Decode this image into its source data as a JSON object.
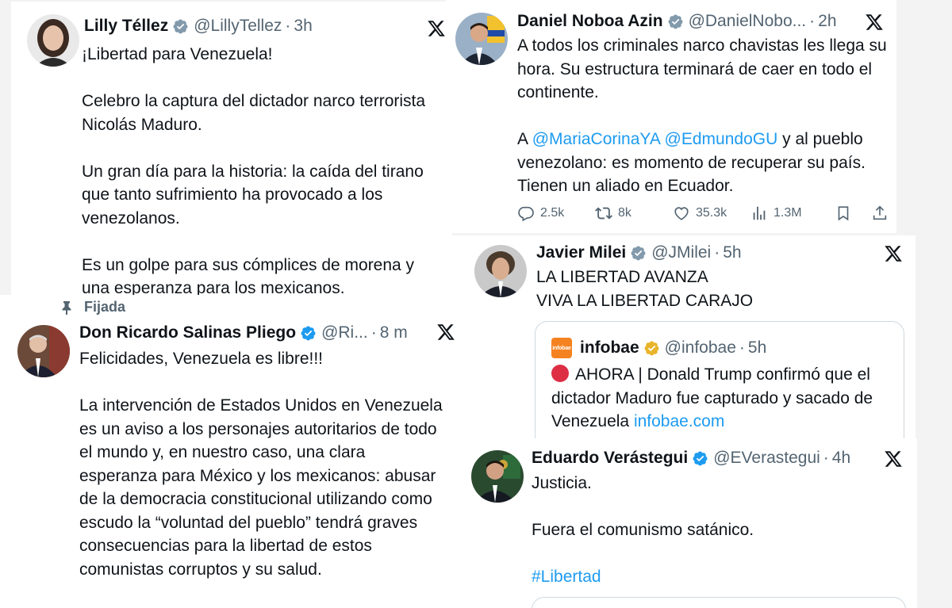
{
  "tweets": {
    "lilly": {
      "name": "Lilly Téllez",
      "handle": "@LillyTellez",
      "time": "3h",
      "paragraphs": [
        "¡Libertad para Venezuela!",
        "Celebro la captura del dictador narco terrorista Nicolás Maduro.",
        "Un gran día para la historia: la caída del tirano que tanto sufrimiento ha provocado a los venezolanos.",
        "Es un golpe para sus cómplices de morena y una esperanza para los mexicanos."
      ]
    },
    "noboa": {
      "name": "Daniel Noboa Azin",
      "handle": "@DanielNobo...",
      "time": "2h",
      "paragraph1": "A todos los criminales narco chavistas les llega su hora. Su estructura terminará de caer en todo el continente.",
      "p2_prefix": "A",
      "mention1": "@MariaCorinaYA",
      "mention2": "@EdmundoGU",
      "p2_suffix": "y al pueblo venezolano: es momento de recuperar su país. Tienen un aliado en Ecuador.",
      "replies": "2.5k",
      "reposts": "8k",
      "likes": "35.3k",
      "views": "1.3M"
    },
    "milei": {
      "name": "Javier Milei",
      "handle": "@JMilei",
      "time": "5h",
      "lines": [
        "LA LIBERTAD AVANZA",
        "VIVA LA LIBERTAD CARAJO"
      ],
      "quote": {
        "logo_text": "infobae",
        "name": "infobae",
        "handle": "@infobae",
        "time": "5h",
        "text": "AHORA | Donald Trump confirmó que el dictador Maduro fue capturado y sacado de Venezuela",
        "link": "infobae.com"
      }
    },
    "salinas": {
      "pinned_label": "Fijada",
      "name": "Don Ricardo Salinas Pliego",
      "handle": "@Ri...",
      "time": "8 m",
      "paragraphs": [
        "Felicidades, Venezuela es libre!!!",
        "La intervención de Estados Unidos en Venezuela es un aviso a los personajes autoritarios de todo el mundo y, en nuestro caso, una clara esperanza para México y los mexicanos: abusar de la democracia constitucional utilizando como escudo la “voluntad del pueblo” tendrá graves consecuencias para la libertad de estos comunistas corruptos y su salud."
      ]
    },
    "verastegui": {
      "name": "Eduardo Verástegui",
      "handle": "@EVerastegui",
      "time": "4h",
      "p1": "Justicia.",
      "p2": "Fuera el comunismo satánico.",
      "hashtag": "#Libertad"
    }
  },
  "colors": {
    "link": "#1d9bf0",
    "verified_gold": "#e8b42a",
    "verified_blue": "#1d9bf0",
    "secondary_text": "#536471"
  }
}
